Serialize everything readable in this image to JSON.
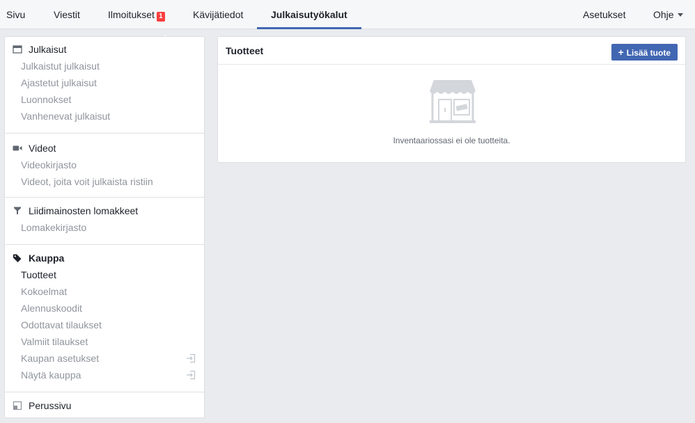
{
  "topnav": {
    "items": [
      {
        "label": "Sivu"
      },
      {
        "label": "Viestit"
      },
      {
        "label": "Ilmoitukset",
        "badge": "1"
      },
      {
        "label": "Kävijätiedot"
      },
      {
        "label": "Julkaisutyökalut",
        "active": true
      }
    ],
    "right": [
      {
        "label": "Asetukset"
      },
      {
        "label": "Ohje"
      }
    ]
  },
  "sidebar": {
    "sections": [
      {
        "title": "Julkaisut",
        "icon": "window-icon",
        "items": [
          "Julkaistut julkaisut",
          "Ajastetut julkaisut",
          "Luonnokset",
          "Vanhenevat julkaisut"
        ]
      },
      {
        "title": "Videot",
        "icon": "video-camera-icon",
        "items": [
          "Videokirjasto",
          "Videot, joita voit julkaista ristiin"
        ]
      },
      {
        "title": "Liidimainosten lomakkeet",
        "icon": "funnel-icon",
        "items": [
          "Lomakekirjasto"
        ]
      },
      {
        "title": "Kauppa",
        "icon": "price-tag-icon",
        "items": [
          "Tuotteet",
          "Kokoelmat",
          "Alennuskoodit",
          "Odottavat tilaukset",
          "Valmiit tilaukset",
          "Kaupan asetukset",
          "Näytä kauppa"
        ],
        "current_item": "Tuotteet",
        "external_items": [
          "Kaupan asetukset",
          "Näytä kauppa"
        ]
      },
      {
        "title": "Perussivu",
        "icon": "page-icon",
        "items": []
      }
    ]
  },
  "main": {
    "title": "Tuotteet",
    "add_button": "Lisää tuote",
    "empty_message": "Inventaariossasi ei ole tuotteita.",
    "illustration": "storefront-icon"
  },
  "colors": {
    "accent": "#4267b2",
    "badge": "#fa3e3e",
    "background": "#e9ebee"
  }
}
